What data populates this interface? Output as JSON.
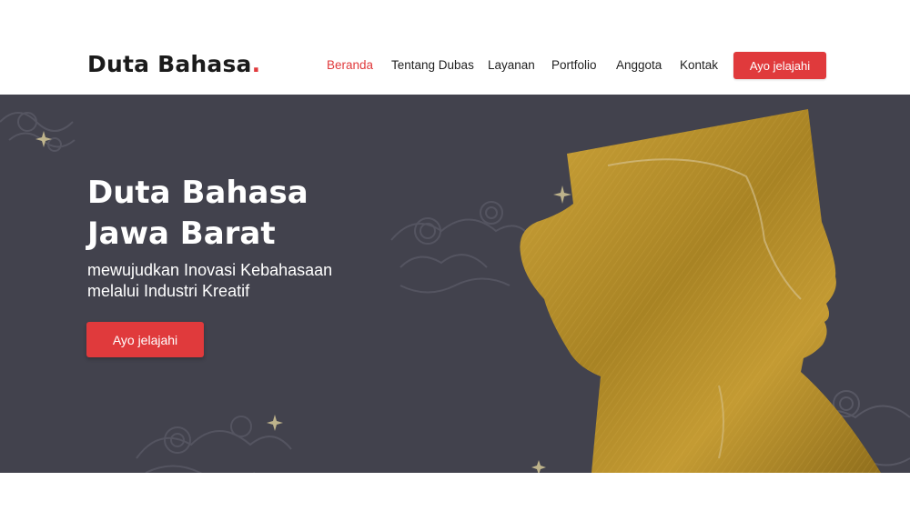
{
  "brand": {
    "name": "Duta Bahasa",
    "dot": ".",
    "accent_color": "#e03a3c"
  },
  "nav": {
    "items": [
      {
        "label": "Beranda",
        "active": true
      },
      {
        "label": "Tentang Dubas",
        "active": false
      },
      {
        "label": "Layanan",
        "active": false
      },
      {
        "label": "Portfolio",
        "active": false
      },
      {
        "label": "Anggota",
        "active": false
      },
      {
        "label": "Kontak",
        "active": false
      }
    ],
    "cta_label": "Ayo jelajahi"
  },
  "hero": {
    "title_line1": "Duta Bahasa",
    "title_line2": "Jawa Barat",
    "subtitle_line1": "mewujudkan Inovasi Kebahasaan",
    "subtitle_line2": "melalui Industri Kreatif",
    "cta_label": "Ayo jelajahi",
    "background_color": "#42424d",
    "silhouette_color": "#b8902a"
  }
}
